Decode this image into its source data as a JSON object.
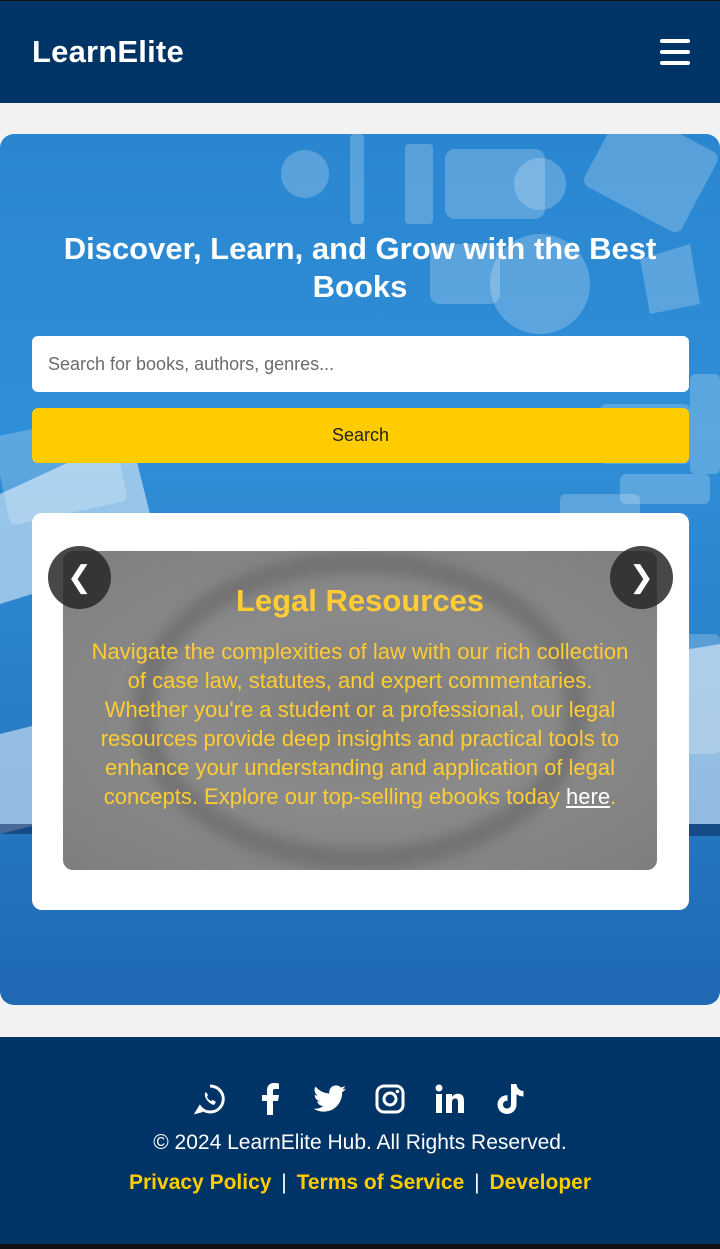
{
  "header": {
    "brand": "LearnElite",
    "menu_icon": "hamburger-icon"
  },
  "hero": {
    "title": "Discover, Learn, and Grow with the Best Books",
    "search": {
      "placeholder": "Search for books, authors, genres...",
      "value": ""
    },
    "search_button": "Search"
  },
  "slider": {
    "prev": "❮",
    "next": "❯",
    "slide": {
      "title": "Legal Resources",
      "text": "Navigate the complexities of law with our rich collection of case law, statutes, and expert commentaries. Whether you're a student or a professional, our legal resources provide deep insights and practical tools to enhance your understanding and application of legal concepts. Explore our top-selling ebooks today ",
      "link": "here",
      "end": "."
    }
  },
  "footer": {
    "socials": [
      "whatsapp-icon",
      "facebook-icon",
      "twitter-icon",
      "instagram-icon",
      "linkedin-icon",
      "tiktok-icon"
    ],
    "copyright": "© 2024 LearnElite Hub. All Rights Reserved.",
    "links": {
      "privacy": "Privacy Policy",
      "terms": "Terms of Service",
      "developer": "Developer",
      "separator": "|"
    }
  },
  "colors": {
    "navy": "#003366",
    "accent": "#ffcc00",
    "hero_blue": "#2a86d0"
  }
}
